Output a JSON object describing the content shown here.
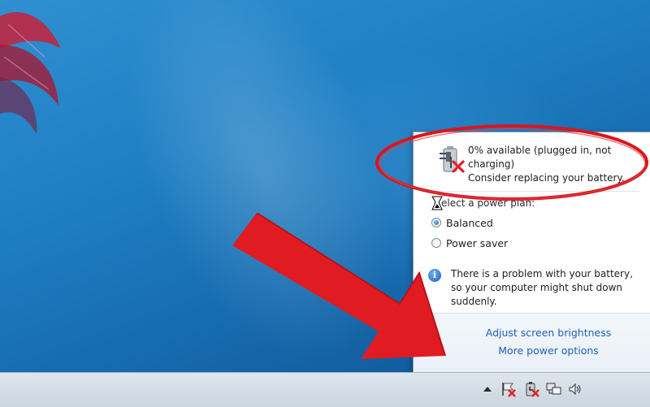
{
  "battery_popup": {
    "status_line1": "0% available (plugged in, not",
    "status_line2": "charging)",
    "status_line3": "Consider replacing your battery.",
    "plan_header": "elect a power plan:",
    "plans": [
      {
        "label": "Balanced",
        "selected": true
      },
      {
        "label": "Power saver",
        "selected": false
      }
    ],
    "warning_line1": "There is a problem with your battery,",
    "warning_line2": "so your computer might shut down",
    "warning_line3": "suddenly.",
    "link_brightness": "Adjust screen brightness",
    "link_more": "More power options"
  },
  "taskbar": {
    "tray_icons": [
      "show-hidden-icons-arrow",
      "action-center-flag-icon",
      "battery-icon",
      "network-icon",
      "volume-icon"
    ]
  },
  "colors": {
    "desktop": "#1f7fc4",
    "link": "#1f5fb6",
    "annotation_red": "#e01b22"
  }
}
